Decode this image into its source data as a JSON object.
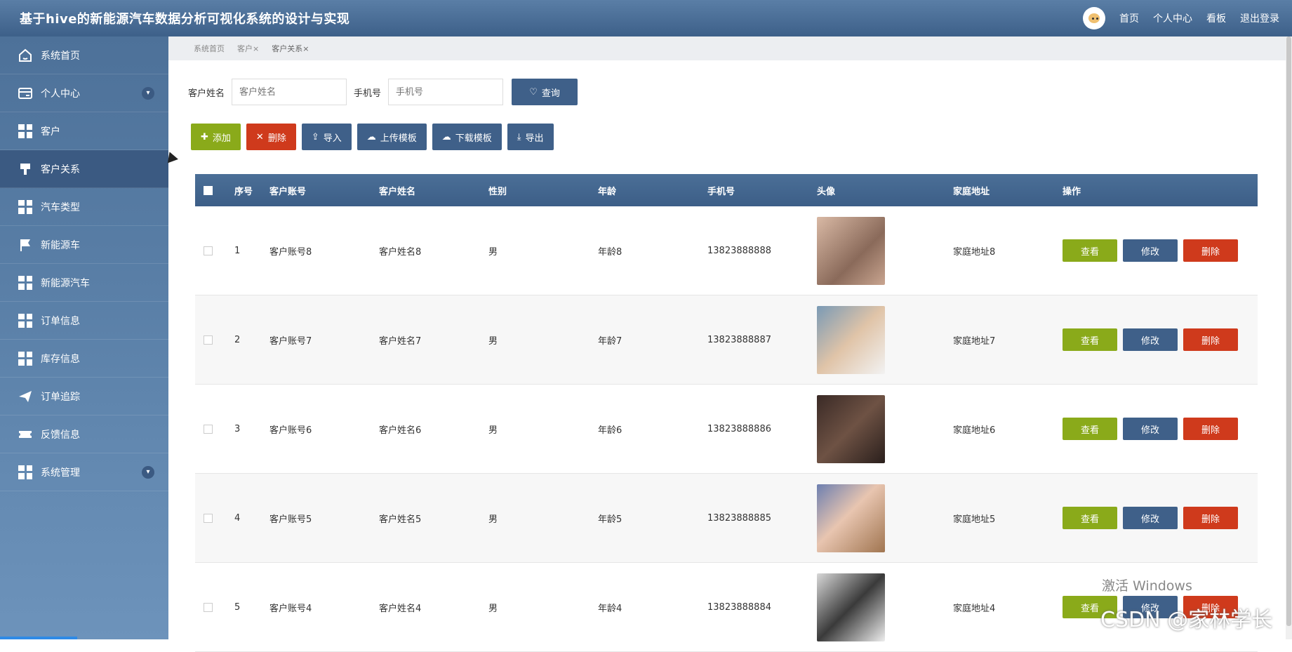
{
  "header": {
    "title": "基于hive的新能源汽车数据分析可视化系统的设计与实现",
    "nav": [
      "首页",
      "个人中心",
      "看板",
      "退出登录"
    ]
  },
  "sidebar": {
    "items": [
      {
        "label": "系统首页",
        "icon": "home-icon"
      },
      {
        "label": "个人中心",
        "icon": "card-icon",
        "expandable": true
      },
      {
        "label": "客户",
        "icon": "grid-icon"
      },
      {
        "label": "客户关系",
        "icon": "brush-icon",
        "active": true
      },
      {
        "label": "汽车类型",
        "icon": "grid-icon"
      },
      {
        "label": "新能源车",
        "icon": "flag-icon"
      },
      {
        "label": "新能源汽车",
        "icon": "grid-icon"
      },
      {
        "label": "订单信息",
        "icon": "grid-icon"
      },
      {
        "label": "库存信息",
        "icon": "grid-icon"
      },
      {
        "label": "订单追踪",
        "icon": "paper-plane-icon"
      },
      {
        "label": "反馈信息",
        "icon": "ticket-icon"
      },
      {
        "label": "系统管理",
        "icon": "grid-icon",
        "expandable": true
      }
    ]
  },
  "tabs": [
    "系统首页",
    "客户",
    "客户关系"
  ],
  "search": {
    "name_label": "客户姓名",
    "name_placeholder": "客户姓名",
    "phone_label": "手机号",
    "phone_placeholder": "手机号",
    "button": "查询"
  },
  "toolbar": {
    "add": "添加",
    "delete": "删除",
    "import": "导入",
    "upload_template": "上传模板",
    "download_template": "下载模板",
    "export": "导出"
  },
  "table": {
    "headers": [
      "序号",
      "客户账号",
      "客户姓名",
      "性别",
      "年龄",
      "手机号",
      "头像",
      "家庭地址",
      "操作"
    ],
    "rows": [
      {
        "no": "1",
        "account": "客户账号8",
        "name": "客户姓名8",
        "sex": "男",
        "age": "年龄8",
        "phone": "13823888888",
        "address": "家庭地址8"
      },
      {
        "no": "2",
        "account": "客户账号7",
        "name": "客户姓名7",
        "sex": "男",
        "age": "年龄7",
        "phone": "13823888887",
        "address": "家庭地址7"
      },
      {
        "no": "3",
        "account": "客户账号6",
        "name": "客户姓名6",
        "sex": "男",
        "age": "年龄6",
        "phone": "13823888886",
        "address": "家庭地址6"
      },
      {
        "no": "4",
        "account": "客户账号5",
        "name": "客户姓名5",
        "sex": "男",
        "age": "年龄5",
        "phone": "13823888885",
        "address": "家庭地址5"
      },
      {
        "no": "5",
        "account": "客户账号4",
        "name": "客户姓名4",
        "sex": "男",
        "age": "年龄4",
        "phone": "13823888884",
        "address": "家庭地址4"
      }
    ],
    "actions": {
      "view": "查看",
      "edit": "修改",
      "delete": "删除"
    }
  },
  "overlay": {
    "windows_watermark": "激活 Windows",
    "csdn_watermark": "CSDN @家林学长"
  },
  "colors": {
    "primary": "#3f6089",
    "success": "#8aaa1a",
    "danger": "#cf3a1c"
  }
}
